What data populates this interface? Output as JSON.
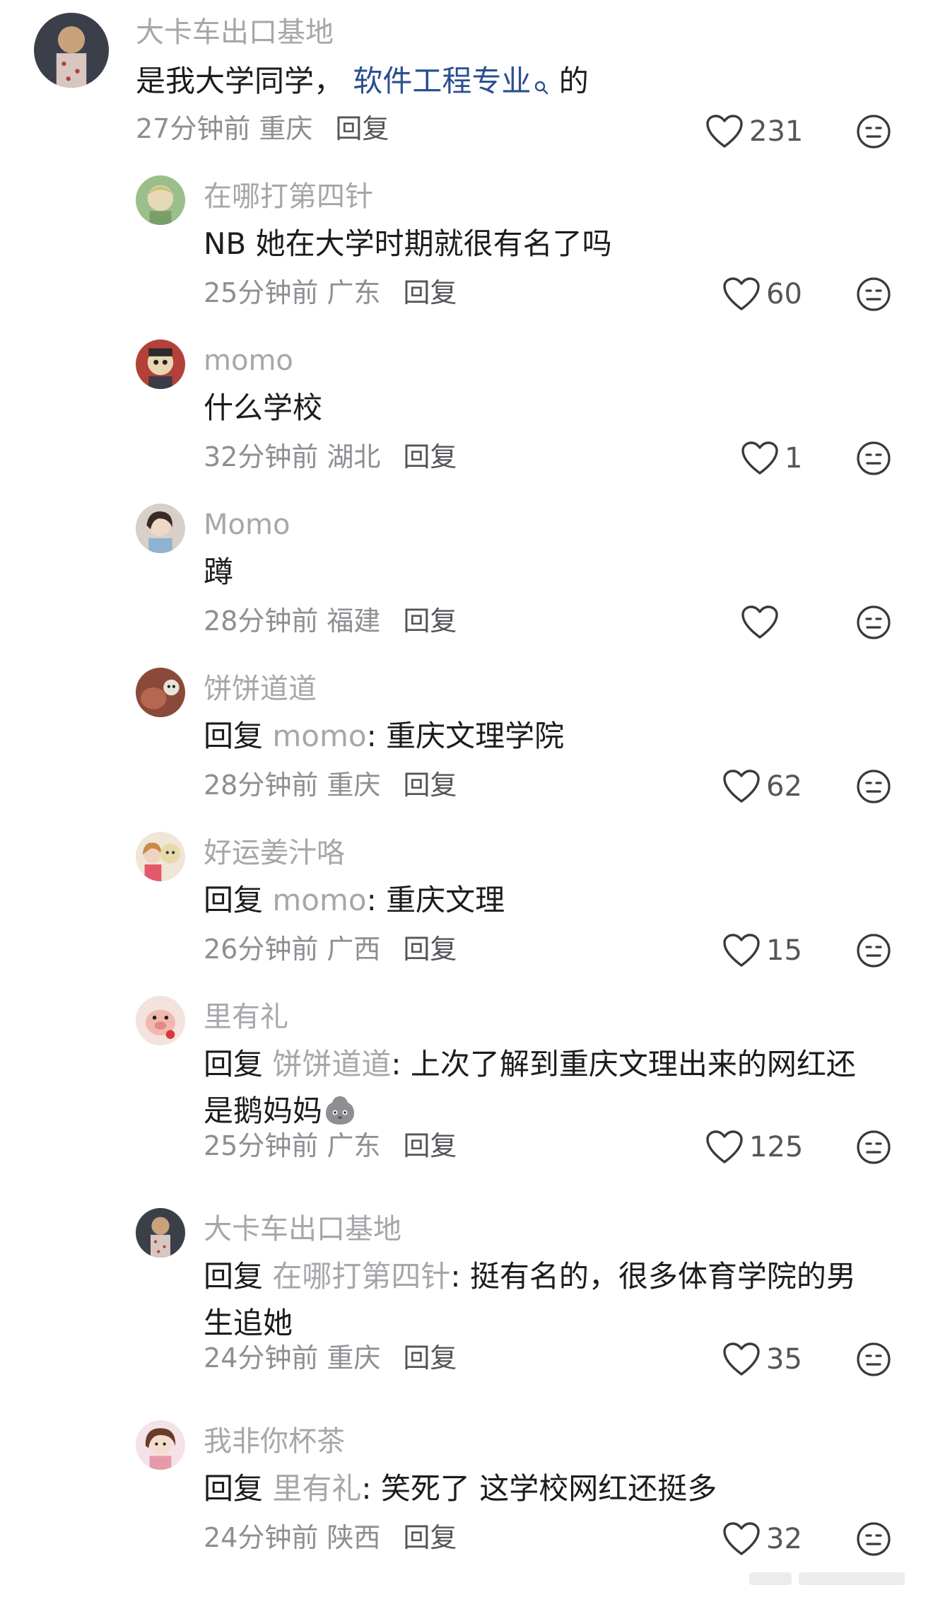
{
  "comments": [
    {
      "username": "大卡车出口基地",
      "text_before_link": "是我大学同学，",
      "link_text": "软件工程专业",
      "text_after_link": "的",
      "time": "27分钟前",
      "location": "重庆",
      "reply_label": "回复",
      "likes": "231"
    },
    {
      "username": "在哪打第四针",
      "text": "NB 她在大学时期就很有名了吗",
      "time": "25分钟前",
      "location": "广东",
      "reply_label": "回复",
      "likes": "60"
    },
    {
      "username": "momo",
      "text": "什么学校",
      "time": "32分钟前",
      "location": "湖北",
      "reply_label": "回复",
      "likes": "1"
    },
    {
      "username": "Momo",
      "text": "蹲",
      "time": "28分钟前",
      "location": "福建",
      "reply_label": "回复",
      "likes": ""
    },
    {
      "username": "饼饼道道",
      "reply_prefix": "回复",
      "reply_to": "momo",
      "text": ": 重庆文理学院",
      "time": "28分钟前",
      "location": "重庆",
      "reply_label": "回复",
      "likes": "62"
    },
    {
      "username": "好运姜汁咯",
      "reply_prefix": "回复",
      "reply_to": "momo",
      "text": ": 重庆文理",
      "time": "26分钟前",
      "location": "广西",
      "reply_label": "回复",
      "likes": "15"
    },
    {
      "username": "里有礼",
      "reply_prefix": "回复",
      "reply_to": "饼饼道道",
      "text": ": 上次了解到重庆文理出来的网红还是鹅妈妈",
      "emoji": "blob-emoji",
      "time": "25分钟前",
      "location": "广东",
      "reply_label": "回复",
      "likes": "125"
    },
    {
      "username": "大卡车出口基地",
      "reply_prefix": "回复",
      "reply_to": "在哪打第四针",
      "text": ": 挺有名的，很多体育学院的男生追她",
      "time": "24分钟前",
      "location": "重庆",
      "reply_label": "回复",
      "likes": "35"
    },
    {
      "username": "我非你杯茶",
      "reply_prefix": "回复",
      "reply_to": "里有礼",
      "text": ": 笑死了 这学校网红还挺多",
      "time": "24分钟前",
      "location": "陕西",
      "reply_label": "回复",
      "likes": "32"
    }
  ],
  "icons": {
    "like": "heart-outline-icon",
    "dislike": "neutral-face-icon",
    "link_search": "search-icon"
  },
  "colors": {
    "username": "#a6a6ab",
    "body": "#1c1c1e",
    "meta": "#8e8e93",
    "link": "#2a4f8f",
    "icon": "#3a3a3c"
  }
}
